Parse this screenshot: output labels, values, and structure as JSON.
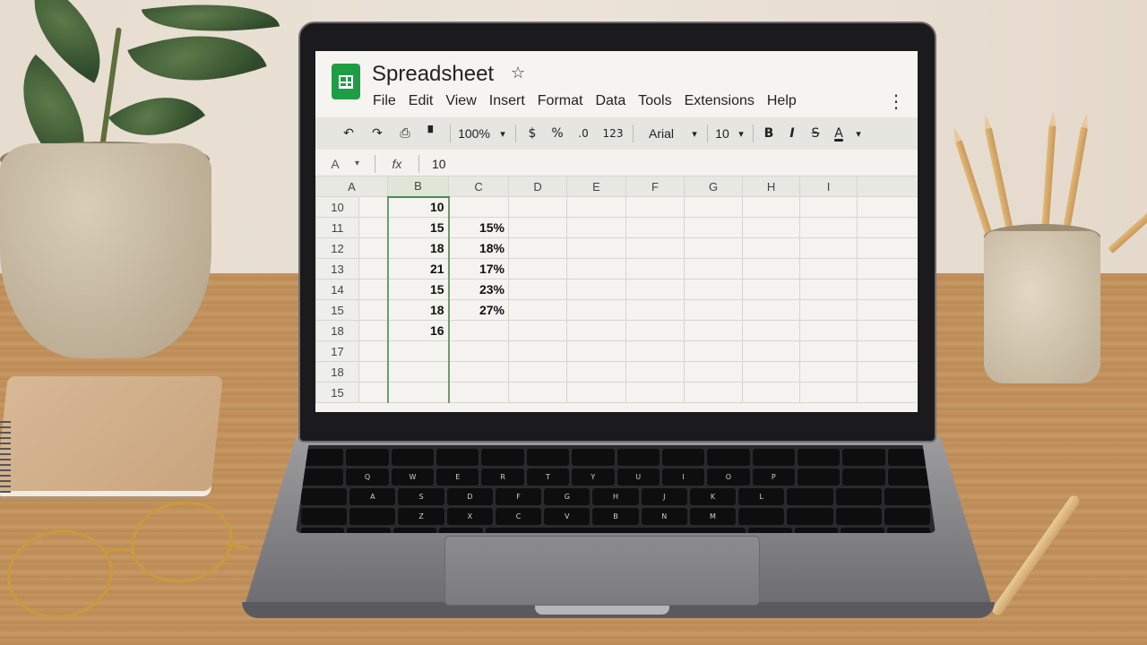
{
  "app": {
    "title": "Spreadsheet",
    "star_icon": "☆",
    "menu": [
      "File",
      "Edit",
      "View",
      "Insert",
      "Format",
      "Data",
      "Tools",
      "Extensions",
      "Help"
    ],
    "more_icon": "⋮"
  },
  "toolbar": {
    "undo_icon": "↶",
    "redo_icon": "↷",
    "print_icon": "⎙",
    "paint_format_icon": "▘",
    "zoom": "100%",
    "currency": "$",
    "percent": "%",
    "decrease_decimal": ".0",
    "more_formats": "123",
    "font": "Arial",
    "font_size": "10",
    "bold": "B",
    "italic": "I",
    "strikethrough": "S",
    "text_color": "A",
    "dropdown_icon": "▾"
  },
  "formula_bar": {
    "cell_ref": "A",
    "fx_icon": "fx",
    "value": "10"
  },
  "grid": {
    "columns": [
      "A",
      "B",
      "C",
      "D",
      "E",
      "F",
      "G",
      "H",
      "I"
    ],
    "rows": [
      {
        "num": "10",
        "cells": [
          "",
          "10",
          "",
          "",
          "",
          "",
          "",
          "",
          ""
        ]
      },
      {
        "num": "11",
        "cells": [
          "",
          "15",
          "15%",
          "",
          "",
          "",
          "",
          "",
          ""
        ]
      },
      {
        "num": "12",
        "cells": [
          "",
          "18",
          "18%",
          "",
          "",
          "",
          "",
          "",
          ""
        ]
      },
      {
        "num": "13",
        "cells": [
          "",
          "21",
          "17%",
          "",
          "",
          "",
          "",
          "",
          ""
        ]
      },
      {
        "num": "14",
        "cells": [
          "",
          "15",
          "23%",
          "",
          "",
          "",
          "",
          "",
          ""
        ]
      },
      {
        "num": "15",
        "cells": [
          "",
          "18",
          "27%",
          "",
          "",
          "",
          "",
          "",
          ""
        ]
      },
      {
        "num": "18",
        "cells": [
          "",
          "16",
          "",
          "",
          "",
          "",
          "",
          "",
          ""
        ]
      },
      {
        "num": "17",
        "cells": [
          "",
          "",
          "",
          "",
          "",
          "",
          "",
          "",
          ""
        ]
      },
      {
        "num": "18",
        "cells": [
          "",
          "",
          "",
          "",
          "",
          "",
          "",
          "",
          ""
        ]
      },
      {
        "num": "15",
        "cells": [
          "",
          "",
          "",
          "",
          "",
          "",
          "",
          "",
          ""
        ]
      }
    ]
  },
  "keyboard": {
    "rows": [
      [
        "",
        "",
        "",
        "",
        "",
        "",
        "",
        "",
        "",
        "",
        "",
        "",
        "",
        ""
      ],
      [
        "",
        "Q",
        "W",
        "E",
        "R",
        "T",
        "Y",
        "U",
        "I",
        "O",
        "P",
        "",
        "",
        ""
      ],
      [
        "",
        "A",
        "S",
        "D",
        "F",
        "G",
        "H",
        "J",
        "K",
        "L",
        "",
        "",
        ""
      ],
      [
        "",
        "",
        "Z",
        "X",
        "C",
        "V",
        "B",
        "N",
        "M",
        "",
        "",
        "",
        ""
      ],
      [
        "",
        "",
        "",
        "",
        "",
        "",
        "",
        "",
        ""
      ]
    ]
  },
  "colors": {
    "sheets_green": "#1e9d45",
    "selection_green": "#4a8a5a"
  }
}
